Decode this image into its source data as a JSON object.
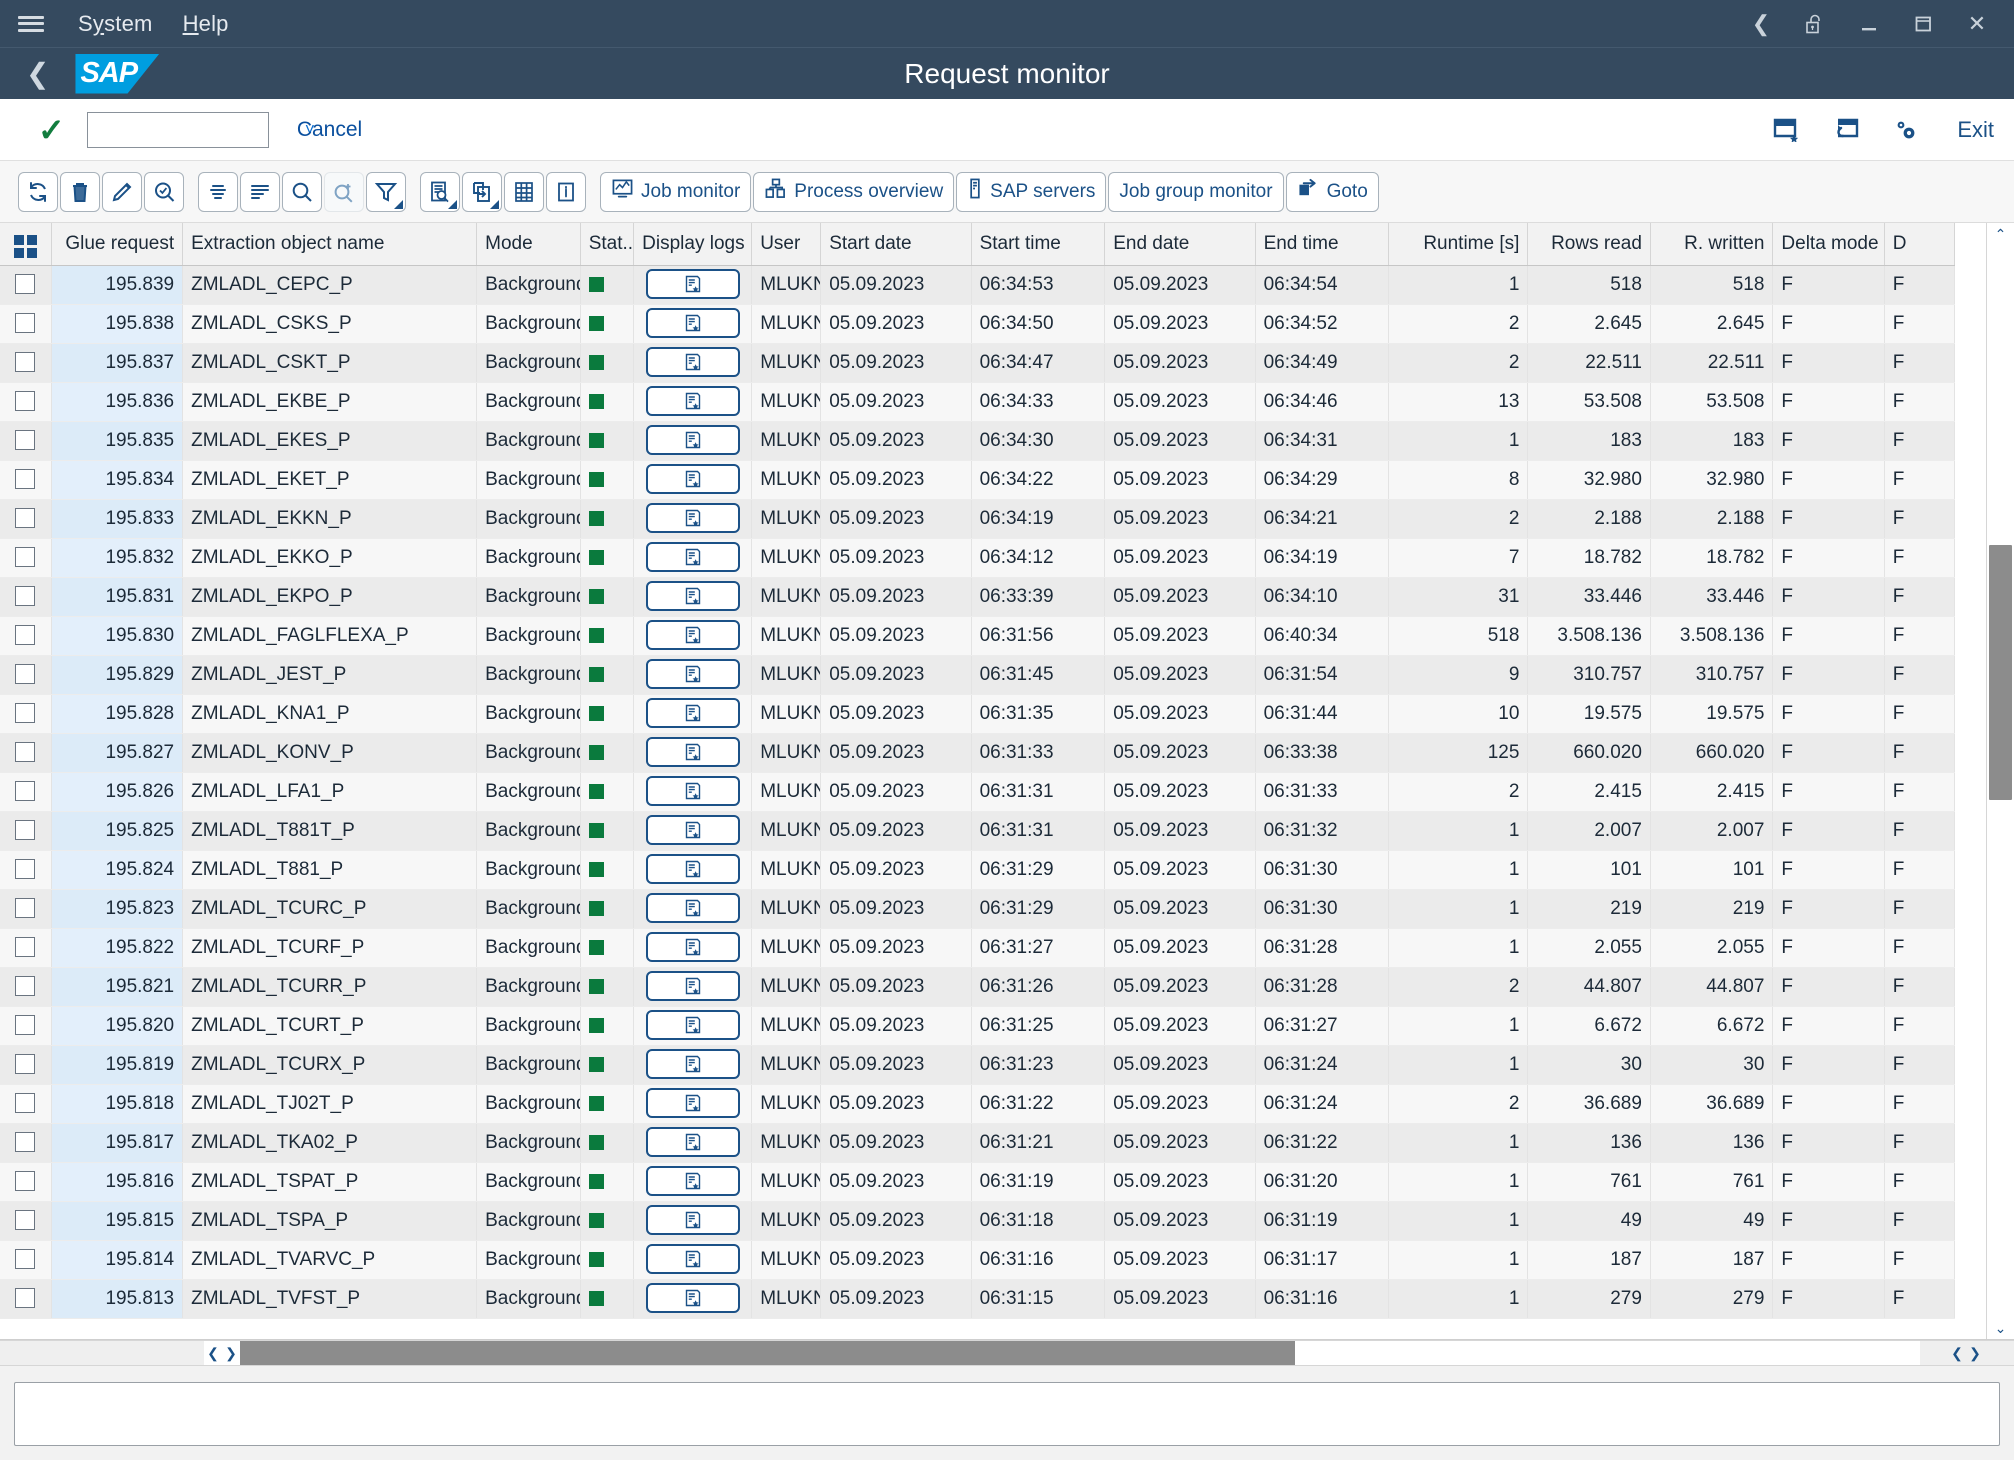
{
  "window": {
    "menu": {
      "system": "System",
      "help": "Help"
    },
    "controls": [
      "back",
      "lock-open",
      "minimize",
      "maximize",
      "close"
    ]
  },
  "shell": {
    "logo": "SAP",
    "title": "Request monitor"
  },
  "actionbar": {
    "ok_icon": "check-icon",
    "command_value": "",
    "command_placeholder": "",
    "cancel_label": "Cancel",
    "exit_label": "Exit",
    "icons": [
      "create-favorite-icon",
      "new-window-icon",
      "customize-icon"
    ]
  },
  "toolbar": {
    "icon_buttons": [
      {
        "name": "refresh-icon",
        "glyph": "refresh"
      },
      {
        "name": "delete-icon",
        "glyph": "trash"
      },
      {
        "name": "edit-icon",
        "glyph": "pencil"
      },
      {
        "name": "check-search-icon",
        "glyph": "check-magnifier"
      },
      {
        "name": "detail-list-icon",
        "glyph": "lines-center"
      },
      {
        "name": "summary-list-icon",
        "glyph": "lines-left"
      },
      {
        "name": "find-icon",
        "glyph": "magnifier"
      },
      {
        "name": "find-next-icon",
        "glyph": "magnifier-plus"
      },
      {
        "name": "filter-icon",
        "glyph": "funnel",
        "caret": true
      },
      {
        "name": "print-preview-icon",
        "glyph": "doc-magnifier",
        "caret": true
      },
      {
        "name": "export-icon",
        "glyph": "export",
        "caret": true
      },
      {
        "name": "spreadsheet-icon",
        "glyph": "table"
      },
      {
        "name": "info-icon",
        "glyph": "info"
      }
    ],
    "labeled_buttons": [
      {
        "label": "Job monitor",
        "icon": "job-monitor-icon"
      },
      {
        "label": "Process overview",
        "icon": "process-overview-icon"
      },
      {
        "label": "SAP servers",
        "icon": "sap-servers-icon"
      },
      {
        "label": "Job group monitor",
        "icon": null
      },
      {
        "label": "Goto",
        "icon": "goto-icon"
      }
    ]
  },
  "table": {
    "columns": [
      {
        "key": "select",
        "label": "",
        "align": "center"
      },
      {
        "key": "glue_request",
        "label": "Glue request",
        "align": "right"
      },
      {
        "key": "extraction_object_name",
        "label": "Extraction object name",
        "align": "left"
      },
      {
        "key": "mode",
        "label": "Mode",
        "align": "left"
      },
      {
        "key": "status",
        "label": "Stat..",
        "align": "left"
      },
      {
        "key": "display_logs",
        "label": "Display logs",
        "align": "center"
      },
      {
        "key": "user",
        "label": "User",
        "align": "left"
      },
      {
        "key": "start_date",
        "label": "Start date",
        "align": "left"
      },
      {
        "key": "start_time",
        "label": "Start time",
        "align": "left"
      },
      {
        "key": "end_date",
        "label": "End date",
        "align": "left"
      },
      {
        "key": "end_time",
        "label": "End time",
        "align": "left"
      },
      {
        "key": "runtime",
        "label": "Runtime [s]",
        "align": "right"
      },
      {
        "key": "rows_read",
        "label": "Rows read",
        "align": "right"
      },
      {
        "key": "rows_written",
        "label": "R. written",
        "align": "right"
      },
      {
        "key": "delta_mode",
        "label": "Delta mode",
        "align": "left"
      },
      {
        "key": "d_col",
        "label": "D",
        "align": "left"
      }
    ],
    "status_color": "#0a7a3d",
    "rows": [
      {
        "glue_request": "195.839",
        "extraction_object_name": "ZMLADL_CEPC_P",
        "mode": "Background",
        "user": "MLUKN...",
        "start_date": "05.09.2023",
        "start_time": "06:34:53",
        "end_date": "05.09.2023",
        "end_time": "06:34:54",
        "runtime": "1",
        "rows_read": "518",
        "rows_written": "518",
        "delta_mode": "F",
        "d_col": "F"
      },
      {
        "glue_request": "195.838",
        "extraction_object_name": "ZMLADL_CSKS_P",
        "mode": "Background",
        "user": "MLUKN...",
        "start_date": "05.09.2023",
        "start_time": "06:34:50",
        "end_date": "05.09.2023",
        "end_time": "06:34:52",
        "runtime": "2",
        "rows_read": "2.645",
        "rows_written": "2.645",
        "delta_mode": "F",
        "d_col": "F"
      },
      {
        "glue_request": "195.837",
        "extraction_object_name": "ZMLADL_CSKT_P",
        "mode": "Background",
        "user": "MLUKN...",
        "start_date": "05.09.2023",
        "start_time": "06:34:47",
        "end_date": "05.09.2023",
        "end_time": "06:34:49",
        "runtime": "2",
        "rows_read": "22.511",
        "rows_written": "22.511",
        "delta_mode": "F",
        "d_col": "F"
      },
      {
        "glue_request": "195.836",
        "extraction_object_name": "ZMLADL_EKBE_P",
        "mode": "Background",
        "user": "MLUKN...",
        "start_date": "05.09.2023",
        "start_time": "06:34:33",
        "end_date": "05.09.2023",
        "end_time": "06:34:46",
        "runtime": "13",
        "rows_read": "53.508",
        "rows_written": "53.508",
        "delta_mode": "F",
        "d_col": "F"
      },
      {
        "glue_request": "195.835",
        "extraction_object_name": "ZMLADL_EKES_P",
        "mode": "Background",
        "user": "MLUKN...",
        "start_date": "05.09.2023",
        "start_time": "06:34:30",
        "end_date": "05.09.2023",
        "end_time": "06:34:31",
        "runtime": "1",
        "rows_read": "183",
        "rows_written": "183",
        "delta_mode": "F",
        "d_col": "F"
      },
      {
        "glue_request": "195.834",
        "extraction_object_name": "ZMLADL_EKET_P",
        "mode": "Background",
        "user": "MLUKN...",
        "start_date": "05.09.2023",
        "start_time": "06:34:22",
        "end_date": "05.09.2023",
        "end_time": "06:34:29",
        "runtime": "8",
        "rows_read": "32.980",
        "rows_written": "32.980",
        "delta_mode": "F",
        "d_col": "F"
      },
      {
        "glue_request": "195.833",
        "extraction_object_name": "ZMLADL_EKKN_P",
        "mode": "Background",
        "user": "MLUKN...",
        "start_date": "05.09.2023",
        "start_time": "06:34:19",
        "end_date": "05.09.2023",
        "end_time": "06:34:21",
        "runtime": "2",
        "rows_read": "2.188",
        "rows_written": "2.188",
        "delta_mode": "F",
        "d_col": "F"
      },
      {
        "glue_request": "195.832",
        "extraction_object_name": "ZMLADL_EKKO_P",
        "mode": "Background",
        "user": "MLUKN...",
        "start_date": "05.09.2023",
        "start_time": "06:34:12",
        "end_date": "05.09.2023",
        "end_time": "06:34:19",
        "runtime": "7",
        "rows_read": "18.782",
        "rows_written": "18.782",
        "delta_mode": "F",
        "d_col": "F"
      },
      {
        "glue_request": "195.831",
        "extraction_object_name": "ZMLADL_EKPO_P",
        "mode": "Background",
        "user": "MLUKN...",
        "start_date": "05.09.2023",
        "start_time": "06:33:39",
        "end_date": "05.09.2023",
        "end_time": "06:34:10",
        "runtime": "31",
        "rows_read": "33.446",
        "rows_written": "33.446",
        "delta_mode": "F",
        "d_col": "F"
      },
      {
        "glue_request": "195.830",
        "extraction_object_name": "ZMLADL_FAGLFLEXA_P",
        "mode": "Background",
        "user": "MLUKN...",
        "start_date": "05.09.2023",
        "start_time": "06:31:56",
        "end_date": "05.09.2023",
        "end_time": "06:40:34",
        "runtime": "518",
        "rows_read": "3.508.136",
        "rows_written": "3.508.136",
        "delta_mode": "F",
        "d_col": "F"
      },
      {
        "glue_request": "195.829",
        "extraction_object_name": "ZMLADL_JEST_P",
        "mode": "Background",
        "user": "MLUKN...",
        "start_date": "05.09.2023",
        "start_time": "06:31:45",
        "end_date": "05.09.2023",
        "end_time": "06:31:54",
        "runtime": "9",
        "rows_read": "310.757",
        "rows_written": "310.757",
        "delta_mode": "F",
        "d_col": "F"
      },
      {
        "glue_request": "195.828",
        "extraction_object_name": "ZMLADL_KNA1_P",
        "mode": "Background",
        "user": "MLUKN...",
        "start_date": "05.09.2023",
        "start_time": "06:31:35",
        "end_date": "05.09.2023",
        "end_time": "06:31:44",
        "runtime": "10",
        "rows_read": "19.575",
        "rows_written": "19.575",
        "delta_mode": "F",
        "d_col": "F"
      },
      {
        "glue_request": "195.827",
        "extraction_object_name": "ZMLADL_KONV_P",
        "mode": "Background",
        "user": "MLUKN...",
        "start_date": "05.09.2023",
        "start_time": "06:31:33",
        "end_date": "05.09.2023",
        "end_time": "06:33:38",
        "runtime": "125",
        "rows_read": "660.020",
        "rows_written": "660.020",
        "delta_mode": "F",
        "d_col": "F"
      },
      {
        "glue_request": "195.826",
        "extraction_object_name": "ZMLADL_LFA1_P",
        "mode": "Background",
        "user": "MLUKN...",
        "start_date": "05.09.2023",
        "start_time": "06:31:31",
        "end_date": "05.09.2023",
        "end_time": "06:31:33",
        "runtime": "2",
        "rows_read": "2.415",
        "rows_written": "2.415",
        "delta_mode": "F",
        "d_col": "F"
      },
      {
        "glue_request": "195.825",
        "extraction_object_name": "ZMLADL_T881T_P",
        "mode": "Background",
        "user": "MLUKN...",
        "start_date": "05.09.2023",
        "start_time": "06:31:31",
        "end_date": "05.09.2023",
        "end_time": "06:31:32",
        "runtime": "1",
        "rows_read": "2.007",
        "rows_written": "2.007",
        "delta_mode": "F",
        "d_col": "F"
      },
      {
        "glue_request": "195.824",
        "extraction_object_name": "ZMLADL_T881_P",
        "mode": "Background",
        "user": "MLUKN...",
        "start_date": "05.09.2023",
        "start_time": "06:31:29",
        "end_date": "05.09.2023",
        "end_time": "06:31:30",
        "runtime": "1",
        "rows_read": "101",
        "rows_written": "101",
        "delta_mode": "F",
        "d_col": "F"
      },
      {
        "glue_request": "195.823",
        "extraction_object_name": "ZMLADL_TCURC_P",
        "mode": "Background",
        "user": "MLUKN...",
        "start_date": "05.09.2023",
        "start_time": "06:31:29",
        "end_date": "05.09.2023",
        "end_time": "06:31:30",
        "runtime": "1",
        "rows_read": "219",
        "rows_written": "219",
        "delta_mode": "F",
        "d_col": "F"
      },
      {
        "glue_request": "195.822",
        "extraction_object_name": "ZMLADL_TCURF_P",
        "mode": "Background",
        "user": "MLUKN...",
        "start_date": "05.09.2023",
        "start_time": "06:31:27",
        "end_date": "05.09.2023",
        "end_time": "06:31:28",
        "runtime": "1",
        "rows_read": "2.055",
        "rows_written": "2.055",
        "delta_mode": "F",
        "d_col": "F"
      },
      {
        "glue_request": "195.821",
        "extraction_object_name": "ZMLADL_TCURR_P",
        "mode": "Background",
        "user": "MLUKN...",
        "start_date": "05.09.2023",
        "start_time": "06:31:26",
        "end_date": "05.09.2023",
        "end_time": "06:31:28",
        "runtime": "2",
        "rows_read": "44.807",
        "rows_written": "44.807",
        "delta_mode": "F",
        "d_col": "F"
      },
      {
        "glue_request": "195.820",
        "extraction_object_name": "ZMLADL_TCURT_P",
        "mode": "Background",
        "user": "MLUKN...",
        "start_date": "05.09.2023",
        "start_time": "06:31:25",
        "end_date": "05.09.2023",
        "end_time": "06:31:27",
        "runtime": "1",
        "rows_read": "6.672",
        "rows_written": "6.672",
        "delta_mode": "F",
        "d_col": "F"
      },
      {
        "glue_request": "195.819",
        "extraction_object_name": "ZMLADL_TCURX_P",
        "mode": "Background",
        "user": "MLUKN...",
        "start_date": "05.09.2023",
        "start_time": "06:31:23",
        "end_date": "05.09.2023",
        "end_time": "06:31:24",
        "runtime": "1",
        "rows_read": "30",
        "rows_written": "30",
        "delta_mode": "F",
        "d_col": "F"
      },
      {
        "glue_request": "195.818",
        "extraction_object_name": "ZMLADL_TJ02T_P",
        "mode": "Background",
        "user": "MLUKN...",
        "start_date": "05.09.2023",
        "start_time": "06:31:22",
        "end_date": "05.09.2023",
        "end_time": "06:31:24",
        "runtime": "2",
        "rows_read": "36.689",
        "rows_written": "36.689",
        "delta_mode": "F",
        "d_col": "F"
      },
      {
        "glue_request": "195.817",
        "extraction_object_name": "ZMLADL_TKA02_P",
        "mode": "Background",
        "user": "MLUKN...",
        "start_date": "05.09.2023",
        "start_time": "06:31:21",
        "end_date": "05.09.2023",
        "end_time": "06:31:22",
        "runtime": "1",
        "rows_read": "136",
        "rows_written": "136",
        "delta_mode": "F",
        "d_col": "F"
      },
      {
        "glue_request": "195.816",
        "extraction_object_name": "ZMLADL_TSPAT_P",
        "mode": "Background",
        "user": "MLUKN...",
        "start_date": "05.09.2023",
        "start_time": "06:31:19",
        "end_date": "05.09.2023",
        "end_time": "06:31:20",
        "runtime": "1",
        "rows_read": "761",
        "rows_written": "761",
        "delta_mode": "F",
        "d_col": "F"
      },
      {
        "glue_request": "195.815",
        "extraction_object_name": "ZMLADL_TSPA_P",
        "mode": "Background",
        "user": "MLUKN...",
        "start_date": "05.09.2023",
        "start_time": "06:31:18",
        "end_date": "05.09.2023",
        "end_time": "06:31:19",
        "runtime": "1",
        "rows_read": "49",
        "rows_written": "49",
        "delta_mode": "F",
        "d_col": "F"
      },
      {
        "glue_request": "195.814",
        "extraction_object_name": "ZMLADL_TVARVC_P",
        "mode": "Background",
        "user": "MLUKN...",
        "start_date": "05.09.2023",
        "start_time": "06:31:16",
        "end_date": "05.09.2023",
        "end_time": "06:31:17",
        "runtime": "1",
        "rows_read": "187",
        "rows_written": "187",
        "delta_mode": "F",
        "d_col": "F"
      },
      {
        "glue_request": "195.813",
        "extraction_object_name": "ZMLADL_TVFST_P",
        "mode": "Background",
        "user": "MLUKN...",
        "start_date": "05.09.2023",
        "start_time": "06:31:15",
        "end_date": "05.09.2023",
        "end_time": "06:31:16",
        "runtime": "1",
        "rows_read": "279",
        "rows_written": "279",
        "delta_mode": "F",
        "d_col": "F"
      }
    ]
  },
  "statusbar": {
    "message": ""
  }
}
